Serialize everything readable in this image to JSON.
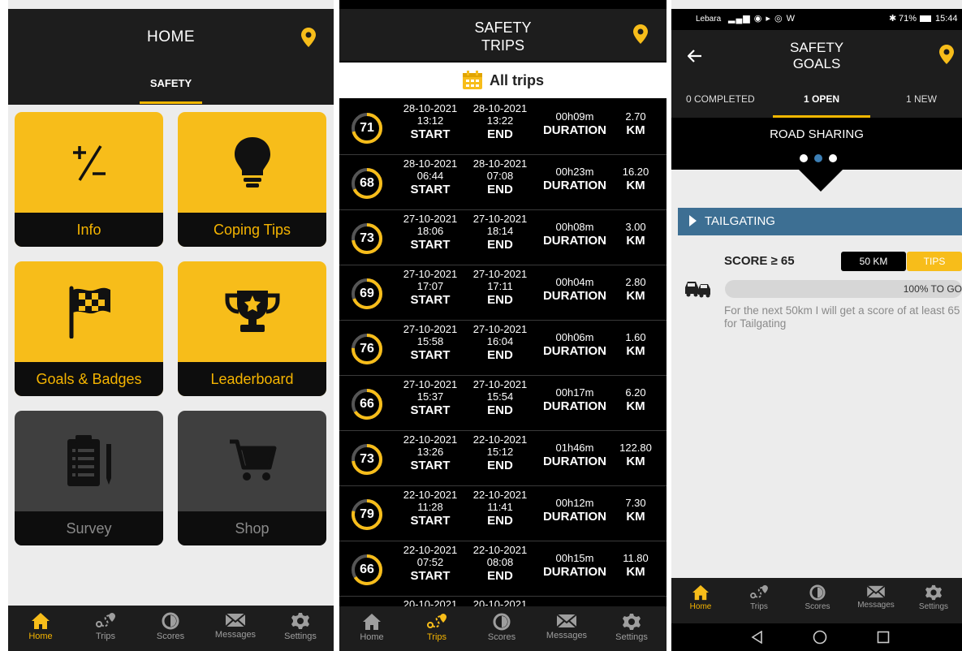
{
  "home": {
    "title": "HOME",
    "tab": "SAFETY",
    "tiles": [
      {
        "label": "Info",
        "icon": "plus-minus-icon"
      },
      {
        "label": "Coping Tips",
        "icon": "lightbulb-icon"
      },
      {
        "label": "Goals & Badges",
        "icon": "checkered-flag-icon"
      },
      {
        "label": "Leaderboard",
        "icon": "trophy-icon"
      },
      {
        "label": "Survey",
        "icon": "clipboard-icon"
      },
      {
        "label": "Shop",
        "icon": "cart-icon"
      }
    ]
  },
  "nav": [
    {
      "label": "Home",
      "icon": "home-icon"
    },
    {
      "label": "Trips",
      "icon": "route-icon"
    },
    {
      "label": "Scores",
      "icon": "scores-icon"
    },
    {
      "label": "Messages",
      "icon": "envelope-icon"
    },
    {
      "label": "Settings",
      "icon": "gear-icon"
    }
  ],
  "trips": {
    "title_line1": "SAFETY",
    "title_line2": "TRIPS",
    "filter": "All trips",
    "start_label": "START",
    "end_label": "END",
    "duration_label": "DURATION",
    "km_label": "KM",
    "rows": [
      {
        "score": "71",
        "start_date": "28-10-2021",
        "start_time": "13:12",
        "end_date": "28-10-2021",
        "end_time": "13:22",
        "duration": "00h09m",
        "km": "2.70"
      },
      {
        "score": "68",
        "start_date": "28-10-2021",
        "start_time": "06:44",
        "end_date": "28-10-2021",
        "end_time": "07:08",
        "duration": "00h23m",
        "km": "16.20"
      },
      {
        "score": "73",
        "start_date": "27-10-2021",
        "start_time": "18:06",
        "end_date": "27-10-2021",
        "end_time": "18:14",
        "duration": "00h08m",
        "km": "3.00"
      },
      {
        "score": "69",
        "start_date": "27-10-2021",
        "start_time": "17:07",
        "end_date": "27-10-2021",
        "end_time": "17:11",
        "duration": "00h04m",
        "km": "2.80"
      },
      {
        "score": "76",
        "start_date": "27-10-2021",
        "start_time": "15:58",
        "end_date": "27-10-2021",
        "end_time": "16:04",
        "duration": "00h06m",
        "km": "1.60"
      },
      {
        "score": "66",
        "start_date": "27-10-2021",
        "start_time": "15:37",
        "end_date": "27-10-2021",
        "end_time": "15:54",
        "duration": "00h17m",
        "km": "6.20"
      },
      {
        "score": "73",
        "start_date": "22-10-2021",
        "start_time": "13:26",
        "end_date": "22-10-2021",
        "end_time": "15:12",
        "duration": "01h46m",
        "km": "122.80"
      },
      {
        "score": "79",
        "start_date": "22-10-2021",
        "start_time": "11:28",
        "end_date": "22-10-2021",
        "end_time": "11:41",
        "duration": "00h12m",
        "km": "7.30"
      },
      {
        "score": "66",
        "start_date": "22-10-2021",
        "start_time": "07:52",
        "end_date": "22-10-2021",
        "end_time": "08:08",
        "duration": "00h15m",
        "km": "11.80"
      }
    ],
    "partial_row": {
      "start_date": "20-10-2021",
      "end_date": "20-10-2021"
    }
  },
  "goals": {
    "status_carrier": "Lebara",
    "status_battery": "71%",
    "status_time": "15:44",
    "title_line1": "SAFETY",
    "title_line2": "GOALS",
    "tab_completed": "0 COMPLETED",
    "tab_open": "1 OPEN",
    "tab_new": "1 NEW",
    "goal_title": "ROAD SHARING",
    "section": "TAILGATING",
    "score_label": "SCORE ≥ 65",
    "km_button": "50 KM",
    "tips_button": "TIPS",
    "progress_text": "100% TO GO",
    "progress_fraction": 0,
    "description": "For the next 50km I will get a score of at least 65 for Tailgating"
  },
  "colors": {
    "accent": "#f7bd1a",
    "dark": "#1d1d1d",
    "section": "#3d6f93"
  }
}
